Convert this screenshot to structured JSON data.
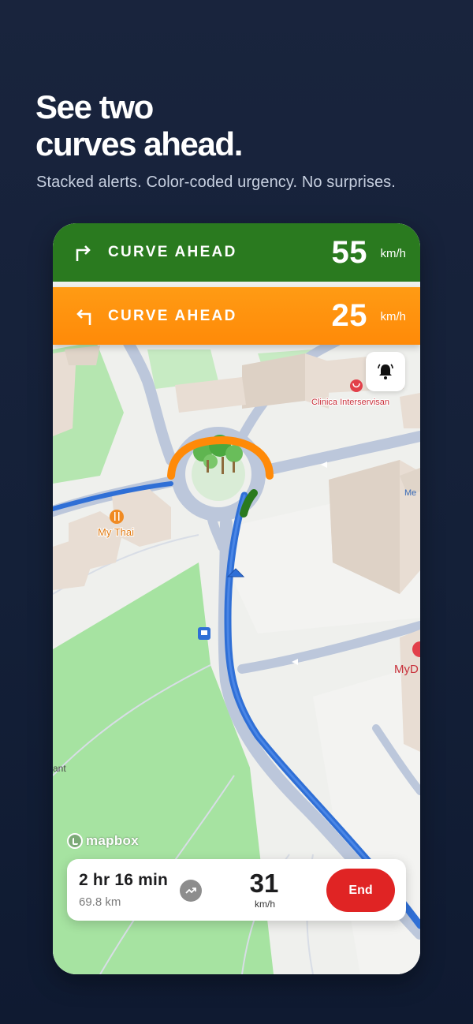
{
  "headline": {
    "line1": "See two",
    "line2": "curves ahead."
  },
  "subtitle": "Stacked alerts. Color-coded urgency. No surprises.",
  "alerts": [
    {
      "label": "CURVE AHEAD",
      "speed": "55",
      "unit": "km/h",
      "direction": "right",
      "color": "#2a7a1f"
    },
    {
      "label": "CURVE AHEAD",
      "speed": "25",
      "unit": "km/h",
      "direction": "left",
      "color": "#ff9013"
    }
  ],
  "map": {
    "places": {
      "clinic": "Clinica Interservisan",
      "restaurant": "My Thai",
      "partial_right": "Me",
      "partial_right2": "MyD",
      "partial_left": "ant"
    },
    "attribution": "mapbox"
  },
  "trip": {
    "eta": "2 hr 16 min",
    "distance": "69.8 km",
    "speed": "31",
    "speed_unit": "km/h",
    "end_label": "End"
  },
  "colors": {
    "route": "#2f6fd6",
    "park": "#a5e3a0",
    "road": "#b9c6dc",
    "building": "#e8ddd3"
  }
}
